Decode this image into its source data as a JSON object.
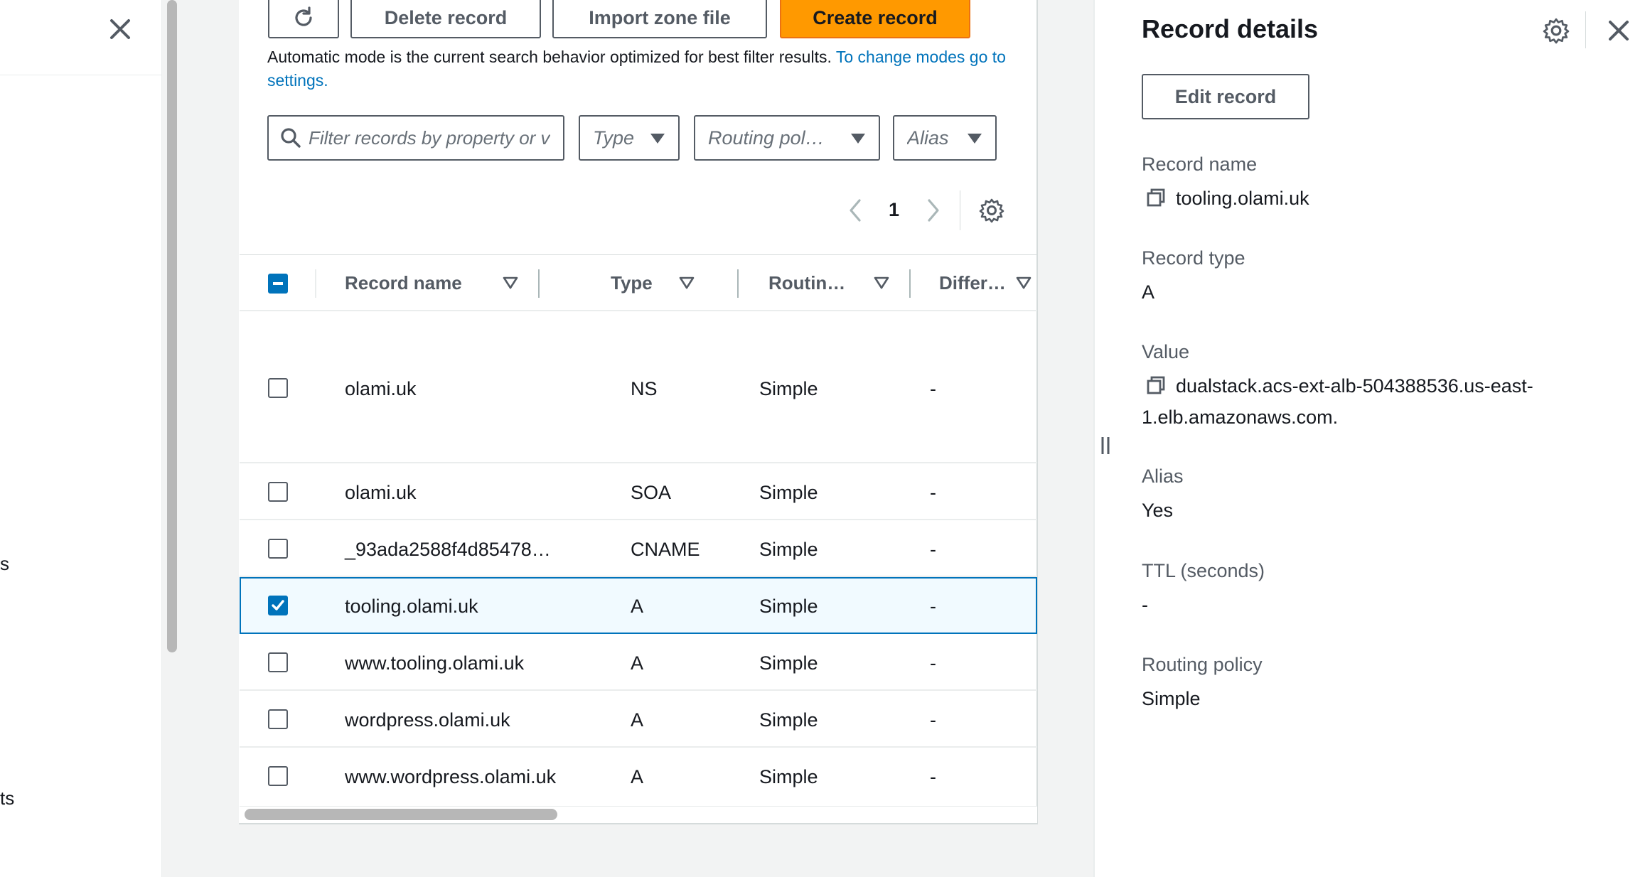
{
  "nav": {
    "fragment_1": "s",
    "fragment_2": "ts"
  },
  "toolbar": {
    "delete_label": "Delete record",
    "import_label": "Import zone file",
    "create_label": "Create record"
  },
  "search_mode": {
    "text": "Automatic mode is the current search behavior optimized for best filter results.",
    "link": "To change modes go to settings."
  },
  "filters": {
    "search_placeholder": "Filter records by property or value",
    "type_label": "Type",
    "routing_label": "Routing pol…",
    "alias_label": "Alias"
  },
  "pagination": {
    "current_page": "1"
  },
  "table": {
    "columns": [
      "Record name",
      "Type",
      "Routin…",
      "Differ…"
    ],
    "rows": [
      {
        "name": "olami.uk",
        "type": "NS",
        "routing": "Simple",
        "diff": "-",
        "selected": false
      },
      {
        "name": "olami.uk",
        "type": "SOA",
        "routing": "Simple",
        "diff": "-",
        "selected": false
      },
      {
        "name": "_93ada2588f4d85478…",
        "type": "CNAME",
        "routing": "Simple",
        "diff": "-",
        "selected": false
      },
      {
        "name": "tooling.olami.uk",
        "type": "A",
        "routing": "Simple",
        "diff": "-",
        "selected": true
      },
      {
        "name": "www.tooling.olami.uk",
        "type": "A",
        "routing": "Simple",
        "diff": "-",
        "selected": false
      },
      {
        "name": "wordpress.olami.uk",
        "type": "A",
        "routing": "Simple",
        "diff": "-",
        "selected": false
      },
      {
        "name": "www.wordpress.olami.uk",
        "type": "A",
        "routing": "Simple",
        "diff": "-",
        "selected": false
      }
    ]
  },
  "details": {
    "title": "Record details",
    "edit_label": "Edit record",
    "record_name_label": "Record name",
    "record_name": "tooling.olami.uk",
    "record_type_label": "Record type",
    "record_type": "A",
    "value_label": "Value",
    "value_line1": "dualstack.acs-ext-alb-504388536.us-east-",
    "value_line2": "1.elb.amazonaws.com.",
    "alias_label": "Alias",
    "alias": "Yes",
    "ttl_label": "TTL (seconds)",
    "ttl": "-",
    "routing_label": "Routing policy",
    "routing": "Simple"
  },
  "colors": {
    "primary": "#ff9900",
    "link": "#0073bb",
    "selected_row_bg": "#f1faff"
  },
  "icons": [
    "close-icon",
    "refresh-icon",
    "search-icon",
    "caret-down-icon",
    "chevron-left-icon",
    "chevron-right-icon",
    "gear-icon",
    "sort-icon",
    "copy-icon",
    "drag-handle-icon"
  ]
}
